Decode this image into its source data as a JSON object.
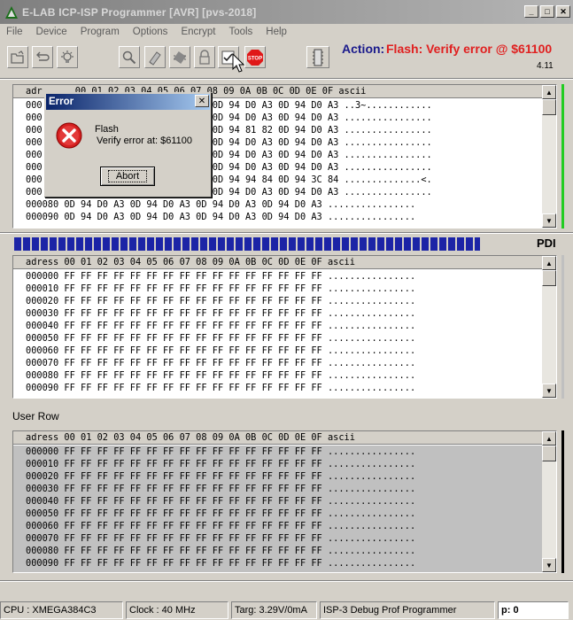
{
  "window": {
    "title": "E-LAB ICP-ISP Programmer [AVR]  [pvs-2018]"
  },
  "menu": [
    "File",
    "Device",
    "Program",
    "Options",
    "Encrypt",
    "Tools",
    "Help"
  ],
  "toolbar_icons": [
    "open-folder-icon",
    "reload-icon",
    "bulb-icon",
    "search-chip-icon",
    "erase-icon",
    "chip-icon",
    "lock-icon",
    "verify-icon",
    "stop-icon",
    "device-icon"
  ],
  "action": {
    "label": "Action:",
    "value": "Flash: Verify error @ $61100"
  },
  "version": "4.11",
  "flash_panel": {
    "header": "adr      00 01 02 03 04 05 06 07 08 09 0A 0B 0C 0D 0E 0F ascii",
    "rows": [
      "000       0D 94 D0 A3 0D 94 D0 A3 0D 94 D0 A3 0D 94 D0 A3 ..3~............",
      "000       0D 94 D0 A3 0D 94 D0 A3 0D 94 D0 A3 0D 94 D0 A3 ................",
      "000       0D 94 D0 A3 0D 94 D0 A3 0D 94 81 82 0D 94 D0 A3 ................",
      "000       0D 94 D0 A3 0D 94 D0 A3 0D 94 D0 A3 0D 94 D0 A3 ................",
      "000       0D 94 D0 A3 0D 94 D0 A3 0D 94 D0 A3 0D 94 D0 A3 ................",
      "000       0D 94 D0 A3 0D 94 D0 A3 0D 94 D0 A3 0D 94 D0 A3 ................",
      "000       0D 94 D0 A3 0D 94 D0 A3 0D 94 94 84 0D 94 3C 84 ..............<.",
      "000       0D 94 D0 A3 0D 94 D0 A3 0D 94 D0 A3 0D 94 D0 A3 ................",
      "000080 0D 94 D0 A3 0D 94 D0 A3 0D 94 D0 A3 0D 94 D0 A3 ................",
      "000090 0D 94 D0 A3 0D 94 D0 A3 0D 94 D0 A3 0D 94 D0 A3 ................"
    ]
  },
  "progress": {
    "fraction": 0.86
  },
  "interface_label": "PDI",
  "eeprom_panel": {
    "header": "adress 00 01 02 03 04 05 06 07 08 09 0A 0B 0C 0D 0E 0F ascii",
    "rows": [
      "000000 FF FF FF FF FF FF FF FF FF FF FF FF FF FF FF FF ................",
      "000010 FF FF FF FF FF FF FF FF FF FF FF FF FF FF FF FF ................",
      "000020 FF FF FF FF FF FF FF FF FF FF FF FF FF FF FF FF ................",
      "000030 FF FF FF FF FF FF FF FF FF FF FF FF FF FF FF FF ................",
      "000040 FF FF FF FF FF FF FF FF FF FF FF FF FF FF FF FF ................",
      "000050 FF FF FF FF FF FF FF FF FF FF FF FF FF FF FF FF ................",
      "000060 FF FF FF FF FF FF FF FF FF FF FF FF FF FF FF FF ................",
      "000070 FF FF FF FF FF FF FF FF FF FF FF FF FF FF FF FF ................",
      "000080 FF FF FF FF FF FF FF FF FF FF FF FF FF FF FF FF ................",
      "000090 FF FF FF FF FF FF FF FF FF FF FF FF FF FF FF FF ................"
    ]
  },
  "userrow_label": "User Row",
  "userrow_panel": {
    "header": "adress 00 01 02 03 04 05 06 07 08 09 0A 0B 0C 0D 0E 0F ascii",
    "rows": [
      "000000 FF FF FF FF FF FF FF FF FF FF FF FF FF FF FF FF ................",
      "000010 FF FF FF FF FF FF FF FF FF FF FF FF FF FF FF FF ................",
      "000020 FF FF FF FF FF FF FF FF FF FF FF FF FF FF FF FF ................",
      "000030 FF FF FF FF FF FF FF FF FF FF FF FF FF FF FF FF ................",
      "000040 FF FF FF FF FF FF FF FF FF FF FF FF FF FF FF FF ................",
      "000050 FF FF FF FF FF FF FF FF FF FF FF FF FF FF FF FF ................",
      "000060 FF FF FF FF FF FF FF FF FF FF FF FF FF FF FF FF ................",
      "000070 FF FF FF FF FF FF FF FF FF FF FF FF FF FF FF FF ................",
      "000080 FF FF FF FF FF FF FF FF FF FF FF FF FF FF FF FF ................",
      "000090 FF FF FF FF FF FF FF FF FF FF FF FF FF FF FF FF ................"
    ]
  },
  "status": {
    "cpu": "CPU : XMEGA384C3",
    "clock": "Clock : 40 MHz",
    "target": "Targ: 3.29V/0mA",
    "programmer": "ISP-3 Debug Prof Programmer",
    "p": "p: 0"
  },
  "dialog": {
    "title": "Error",
    "close": "✕",
    "line1": "Flash",
    "line2": "Verify error at: $61100",
    "button": "Abort"
  },
  "colors": {
    "accent_red": "#e02020",
    "action_blue": "#1a1a8c",
    "progress_blue": "#1c24a6",
    "ok_green": "#22cc22"
  }
}
